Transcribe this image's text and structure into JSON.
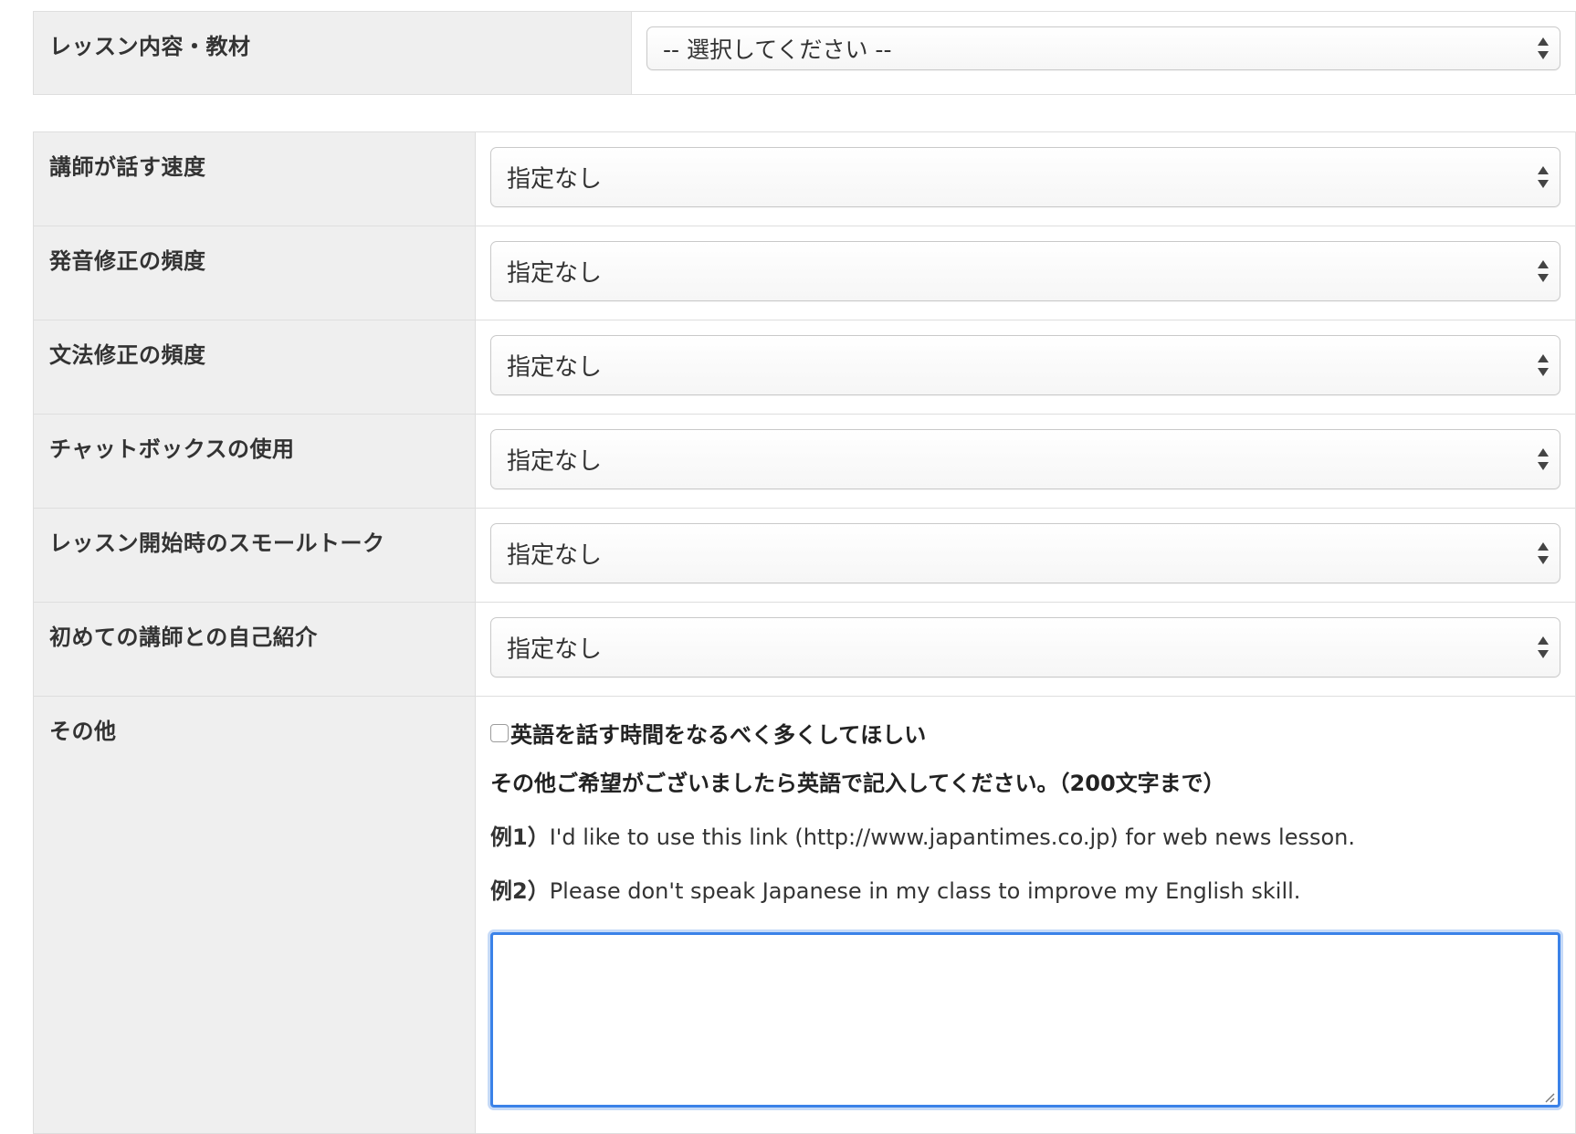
{
  "lesson_content": {
    "label": "レッスン内容・教材",
    "select_value": "-- 選択してください --"
  },
  "preferences": [
    {
      "label": "講師が話す速度",
      "value": "指定なし"
    },
    {
      "label": "発音修正の頻度",
      "value": "指定なし"
    },
    {
      "label": "文法修正の頻度",
      "value": "指定なし"
    },
    {
      "label": "チャットボックスの使用",
      "value": "指定なし"
    },
    {
      "label": "レッスン開始時のスモールトーク",
      "value": "指定なし"
    },
    {
      "label": "初めての講師との自己紹介",
      "value": "指定なし"
    }
  ],
  "other": {
    "label": "その他",
    "checkbox_label": "英語を話す時間をなるべく多くしてほしい",
    "checkbox_checked": false,
    "instruction": "その他ご希望がございましたら英語で記入してください。（200文字まで）",
    "example1_prefix": "例1）",
    "example1_text": "I'd like to use this link (http://www.japantimes.co.jp) for web news lesson.",
    "example2_prefix": "例2）",
    "example2_text": "Please don't speak Japanese in my class to improve my English skill.",
    "textarea_value": ""
  },
  "icons": {
    "select_arrows": "select-updown-arrows-icon",
    "resize": "resize-grip-icon"
  },
  "colors": {
    "label_bg": "#efefef",
    "border": "#dedede",
    "focus": "#3b82e8"
  }
}
